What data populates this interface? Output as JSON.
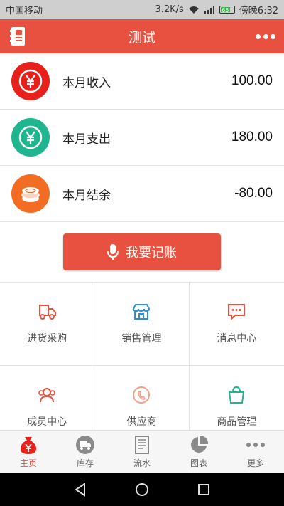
{
  "status_bar": {
    "carrier": "中国移动",
    "speed": "3.2K/s",
    "battery": "65",
    "time": "傍晚6:32"
  },
  "app_bar": {
    "title": "测试"
  },
  "summary": [
    {
      "label": "本月收入",
      "value": "100.00",
      "color": "#e8201c",
      "icon": "yen-icon"
    },
    {
      "label": "本月支出",
      "value": "180.00",
      "color": "#1fb58f",
      "icon": "yen-icon"
    },
    {
      "label": "本月结余",
      "value": "-80.00",
      "color": "#f26c24",
      "icon": "coins-icon"
    }
  ],
  "record_button": {
    "label": "我要记账"
  },
  "grid": [
    {
      "label": "进货采购",
      "icon": "truck-icon",
      "color": "#e8503f"
    },
    {
      "label": "销售管理",
      "icon": "store-icon",
      "color": "#2a8fd6"
    },
    {
      "label": "消息中心",
      "icon": "message-icon",
      "color": "#e8503f"
    },
    {
      "label": "成员中心",
      "icon": "members-icon",
      "color": "#e8503f"
    },
    {
      "label": "供应商",
      "icon": "phone-icon",
      "color": "#f0a08a"
    },
    {
      "label": "商品管理",
      "icon": "bag-icon",
      "color": "#1fb58f"
    }
  ],
  "tabs": [
    {
      "label": "主页",
      "icon": "home-moneybag-icon",
      "active": true
    },
    {
      "label": "库存",
      "icon": "inventory-truck-icon",
      "active": false
    },
    {
      "label": "流水",
      "icon": "ledger-icon",
      "active": false
    },
    {
      "label": "图表",
      "icon": "pie-chart-icon",
      "active": false
    },
    {
      "label": "更多",
      "icon": "more-icon",
      "active": false
    }
  ],
  "colors": {
    "primary": "#e8503f",
    "income": "#e8201c",
    "expense": "#1fb58f",
    "balance": "#f26c24"
  }
}
